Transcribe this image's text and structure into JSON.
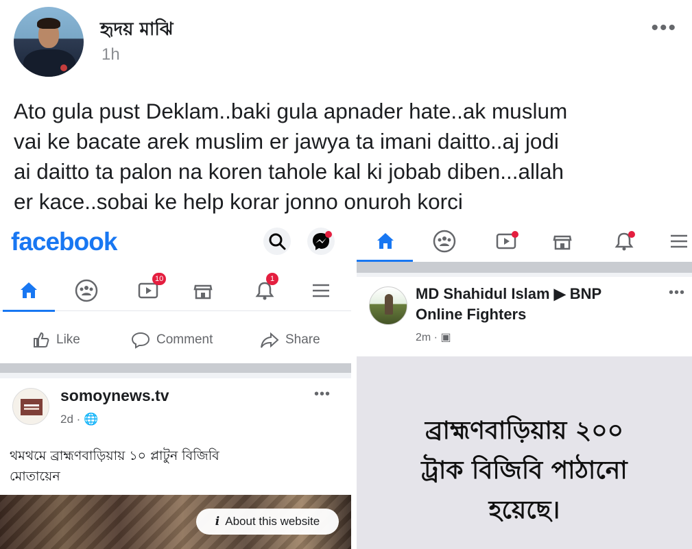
{
  "post": {
    "author": "হৃদয় মাঝি",
    "time": "1h",
    "text_lines": [
      "Ato gula pust Deklam..baki gula apnader hate..ak muslum",
      "vai ke bacate arek muslim er jawya ta imani daitto..aj jodi",
      "ai daitto ta palon na koren tahole kal ki jobab diben...allah",
      "er kace..sobai ke help korar jonno onuroh korci"
    ]
  },
  "left_screenshot": {
    "logo": "facebook",
    "nav": {
      "notifications_badge_a": "10",
      "notifications_badge_b": "1"
    },
    "actions": {
      "like": "Like",
      "comment": "Comment",
      "share": "Share"
    },
    "news": {
      "source": "somoynews.tv",
      "time": "2d · 🌐",
      "headline_line1": "থমথমে ব্রাহ্মণবাড়িয়ায় ১০ প্লাটুন বিজিবি",
      "headline_line2": "মোতায়েন",
      "about": "About this website"
    }
  },
  "right_screenshot": {
    "group": {
      "title_line1": "MD Shahidul Islam ▶ BNP",
      "title_line2": "Online Fighters",
      "time": "2m · ▣"
    },
    "card_text": {
      "line1": "ব্রাহ্মণবাড়িয়ায় ২০০",
      "line2": "ট্রাক বিজিবি পাঠানো",
      "line3": "হয়েছে।"
    }
  },
  "colors": {
    "facebook_blue": "#1877f2",
    "badge_red": "#e41e3f",
    "text": "#1c1e21",
    "muted": "#65676b"
  }
}
